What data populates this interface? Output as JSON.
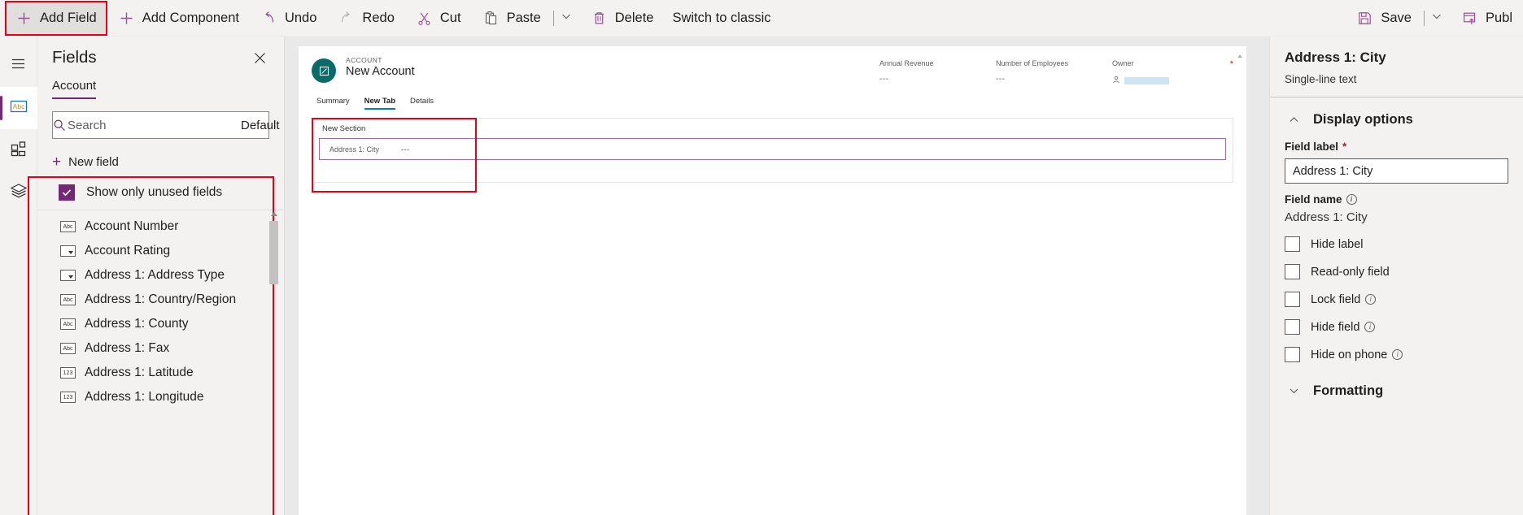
{
  "commandbar": {
    "items": [
      {
        "label": "Add Field",
        "icon": "plus-icon",
        "state": "active"
      },
      {
        "label": "Add Component",
        "icon": "plus-icon",
        "state": "normal"
      },
      {
        "label": "Undo",
        "icon": "undo-icon",
        "state": "normal"
      },
      {
        "label": "Redo",
        "icon": "redo-icon",
        "state": "normal"
      },
      {
        "label": "Cut",
        "icon": "scissors-icon",
        "state": "normal"
      },
      {
        "label": "Paste",
        "icon": "clipboard-icon",
        "state": "split"
      },
      {
        "label": "Delete",
        "icon": "trash-icon",
        "state": "normal"
      },
      {
        "label": "Switch to classic",
        "icon": "",
        "state": "text"
      }
    ],
    "right_items": [
      {
        "label": "Save",
        "icon": "save-icon",
        "state": "split"
      },
      {
        "label": "Publ",
        "icon": "publish-icon",
        "state": "normal"
      }
    ]
  },
  "rail": {
    "items": [
      {
        "name": "menu",
        "icon": "hamburger-icon",
        "selected": false
      },
      {
        "name": "fields",
        "icon": "abc-field-icon",
        "selected": true
      },
      {
        "name": "components",
        "icon": "components-grid-icon",
        "selected": false
      },
      {
        "name": "tree-view",
        "icon": "layers-icon",
        "selected": false
      }
    ]
  },
  "fields_panel": {
    "title": "Fields",
    "close_label": "✕",
    "tab": "Account",
    "search": {
      "placeholder": "Search",
      "value": "",
      "filter_label": "Default"
    },
    "new_field_label": "New field",
    "unused_checkbox": {
      "label": "Show only unused fields",
      "checked": true
    },
    "list": [
      {
        "label": "Account Number",
        "type": "text"
      },
      {
        "label": "Account Rating",
        "type": "choice"
      },
      {
        "label": "Address 1: Address Type",
        "type": "choice"
      },
      {
        "label": "Address 1: Country/Region",
        "type": "text"
      },
      {
        "label": "Address 1: County",
        "type": "text"
      },
      {
        "label": "Address 1: Fax",
        "type": "text"
      },
      {
        "label": "Address 1: Latitude",
        "type": "number"
      },
      {
        "label": "Address 1: Longitude",
        "type": "number"
      }
    ]
  },
  "canvas": {
    "record": {
      "eyebrow": "ACCOUNT",
      "name": "New Account"
    },
    "header_fields": [
      {
        "label": "Annual Revenue",
        "value": "---"
      },
      {
        "label": "Number of Employees",
        "value": "---"
      },
      {
        "label": "Owner",
        "value": "",
        "required": true
      }
    ],
    "tabs": [
      {
        "label": "Summary",
        "selected": false
      },
      {
        "label": "New Tab",
        "selected": true
      },
      {
        "label": "Details",
        "selected": false
      }
    ],
    "section": {
      "title": "New Section",
      "field": {
        "label": "Address 1: City",
        "value": "---"
      }
    }
  },
  "properties": {
    "title": "Address 1: City",
    "subtitle": "Single-line text",
    "display_options": {
      "section_label": "Display options",
      "expanded": true,
      "field_label_label": "Field label",
      "field_label_required": "*",
      "field_label_value": "Address 1: City",
      "field_name_label": "Field name",
      "field_name_value": "Address 1: City",
      "checkboxes": [
        {
          "label": "Hide label",
          "checked": false,
          "info": false
        },
        {
          "label": "Read-only field",
          "checked": false,
          "info": false
        },
        {
          "label": "Lock field",
          "checked": false,
          "info": true
        },
        {
          "label": "Hide field",
          "checked": false,
          "info": true
        },
        {
          "label": "Hide on phone",
          "checked": false,
          "info": true
        }
      ]
    },
    "formatting": {
      "section_label": "Formatting",
      "expanded": false
    }
  },
  "colors": {
    "accent": "#742774",
    "highlight_red": "#e8001b",
    "tab_blue": "#0078d4",
    "logo_teal": "#0b6a6a"
  }
}
